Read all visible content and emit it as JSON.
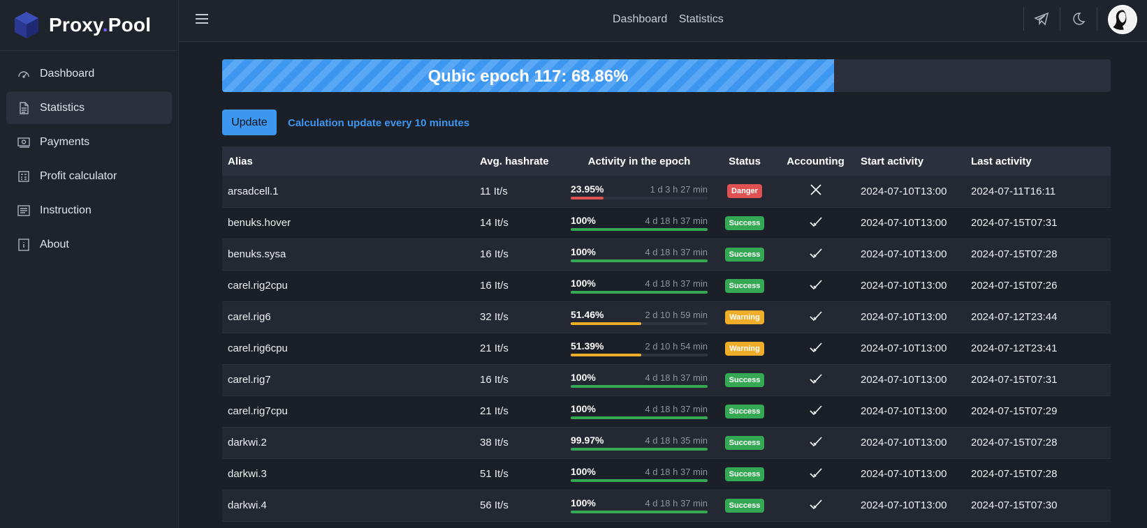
{
  "brand": {
    "name_part1": "Proxy",
    "name_dot": ".",
    "name_part2": "Pool"
  },
  "sidebar": {
    "items": [
      {
        "label": "Dashboard",
        "icon": "gauge-icon"
      },
      {
        "label": "Statistics",
        "icon": "document-icon",
        "active": true
      },
      {
        "label": "Payments",
        "icon": "money-icon"
      },
      {
        "label": "Profit calculator",
        "icon": "calculator-icon"
      },
      {
        "label": "Instruction",
        "icon": "list-icon"
      },
      {
        "label": "About",
        "icon": "info-icon"
      }
    ]
  },
  "topbar": {
    "links": [
      "Dashboard",
      "Statistics"
    ],
    "icons": [
      "menu-icon",
      "telegram-icon",
      "moon-icon",
      "avatar"
    ]
  },
  "epoch": {
    "label": "Qubic epoch 117: 68.86%",
    "progress": 68.86
  },
  "update": {
    "button": "Update",
    "note": "Calculation update every 10 minutes"
  },
  "table": {
    "headers": [
      "Alias",
      "Avg. hashrate",
      "Activity in the epoch",
      "Status",
      "Accounting",
      "Start activity",
      "Last activity"
    ],
    "rows": [
      {
        "alias": "arsadcell.1",
        "hashrate": "11 It/s",
        "pct": "23.95%",
        "pct_value": 23.95,
        "duration": "1 d 3 h 27 min",
        "status": "Danger",
        "accounting": "x",
        "start": "2024-07-10T13:00",
        "last": "2024-07-11T16:11"
      },
      {
        "alias": "benuks.hover",
        "hashrate": "14 It/s",
        "pct": "100%",
        "pct_value": 100,
        "duration": "4 d 18 h 37 min",
        "status": "Success",
        "accounting": "check",
        "start": "2024-07-10T13:00",
        "last": "2024-07-15T07:31"
      },
      {
        "alias": "benuks.sysa",
        "hashrate": "16 It/s",
        "pct": "100%",
        "pct_value": 100,
        "duration": "4 d 18 h 37 min",
        "status": "Success",
        "accounting": "check",
        "start": "2024-07-10T13:00",
        "last": "2024-07-15T07:28"
      },
      {
        "alias": "carel.rig2cpu",
        "hashrate": "16 It/s",
        "pct": "100%",
        "pct_value": 100,
        "duration": "4 d 18 h 37 min",
        "status": "Success",
        "accounting": "check",
        "start": "2024-07-10T13:00",
        "last": "2024-07-15T07:26"
      },
      {
        "alias": "carel.rig6",
        "hashrate": "32 It/s",
        "pct": "51.46%",
        "pct_value": 51.46,
        "duration": "2 d 10 h 59 min",
        "status": "Warning",
        "accounting": "check",
        "start": "2024-07-10T13:00",
        "last": "2024-07-12T23:44"
      },
      {
        "alias": "carel.rig6cpu",
        "hashrate": "21 It/s",
        "pct": "51.39%",
        "pct_value": 51.39,
        "duration": "2 d 10 h 54 min",
        "status": "Warning",
        "accounting": "check",
        "start": "2024-07-10T13:00",
        "last": "2024-07-12T23:41"
      },
      {
        "alias": "carel.rig7",
        "hashrate": "16 It/s",
        "pct": "100%",
        "pct_value": 100,
        "duration": "4 d 18 h 37 min",
        "status": "Success",
        "accounting": "check",
        "start": "2024-07-10T13:00",
        "last": "2024-07-15T07:31"
      },
      {
        "alias": "carel.rig7cpu",
        "hashrate": "21 It/s",
        "pct": "100%",
        "pct_value": 100,
        "duration": "4 d 18 h 37 min",
        "status": "Success",
        "accounting": "check",
        "start": "2024-07-10T13:00",
        "last": "2024-07-15T07:29"
      },
      {
        "alias": "darkwi.2",
        "hashrate": "38 It/s",
        "pct": "99.97%",
        "pct_value": 99.97,
        "duration": "4 d 18 h 35 min",
        "status": "Success",
        "accounting": "check",
        "start": "2024-07-10T13:00",
        "last": "2024-07-15T07:28"
      },
      {
        "alias": "darkwi.3",
        "hashrate": "51 It/s",
        "pct": "100%",
        "pct_value": 100,
        "duration": "4 d 18 h 37 min",
        "status": "Success",
        "accounting": "check",
        "start": "2024-07-10T13:00",
        "last": "2024-07-15T07:28"
      },
      {
        "alias": "darkwi.4",
        "hashrate": "56 It/s",
        "pct": "100%",
        "pct_value": 100,
        "duration": "4 d 18 h 37 min",
        "status": "Success",
        "accounting": "check",
        "start": "2024-07-10T13:00",
        "last": "2024-07-15T07:30"
      }
    ]
  },
  "colors": {
    "accent": "#3d96f0",
    "success": "#34a853",
    "warning": "#f0ad2a",
    "danger": "#e05252",
    "brand_dot": "#7b61ff"
  }
}
